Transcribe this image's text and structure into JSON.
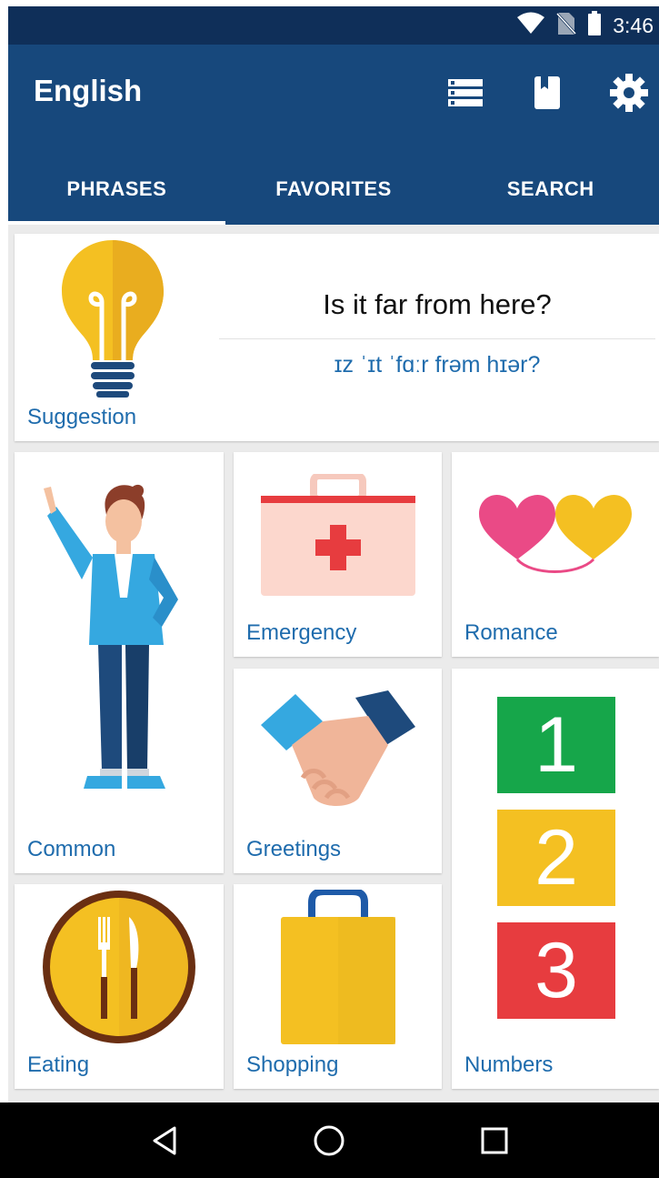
{
  "status_bar": {
    "time": "3:46"
  },
  "app_bar": {
    "title": "English",
    "actions": [
      "list-icon",
      "book-icon",
      "gear-icon"
    ]
  },
  "tabs": [
    {
      "label": "PHRASES",
      "active": true
    },
    {
      "label": "FAVORITES",
      "active": false
    },
    {
      "label": "SEARCH",
      "active": false
    }
  ],
  "suggestion": {
    "label": "Suggestion",
    "phrase": "Is it far from here?",
    "ipa": "ɪz ˈɪt ˈfɑːr frəm hɪər?"
  },
  "categories": {
    "common": "Common",
    "emergency": "Emergency",
    "romance": "Romance",
    "greetings": "Greetings",
    "numbers": "Numbers",
    "eating": "Eating",
    "shopping": "Shopping"
  },
  "numbers_tiles": [
    "1",
    "2",
    "3"
  ],
  "nav": [
    "back-icon",
    "home-icon",
    "recents-icon"
  ],
  "colors": {
    "status_bar": "#0f2f59",
    "app_bar": "#17487c",
    "label": "#1f6cad",
    "background": "#ebebeb"
  }
}
